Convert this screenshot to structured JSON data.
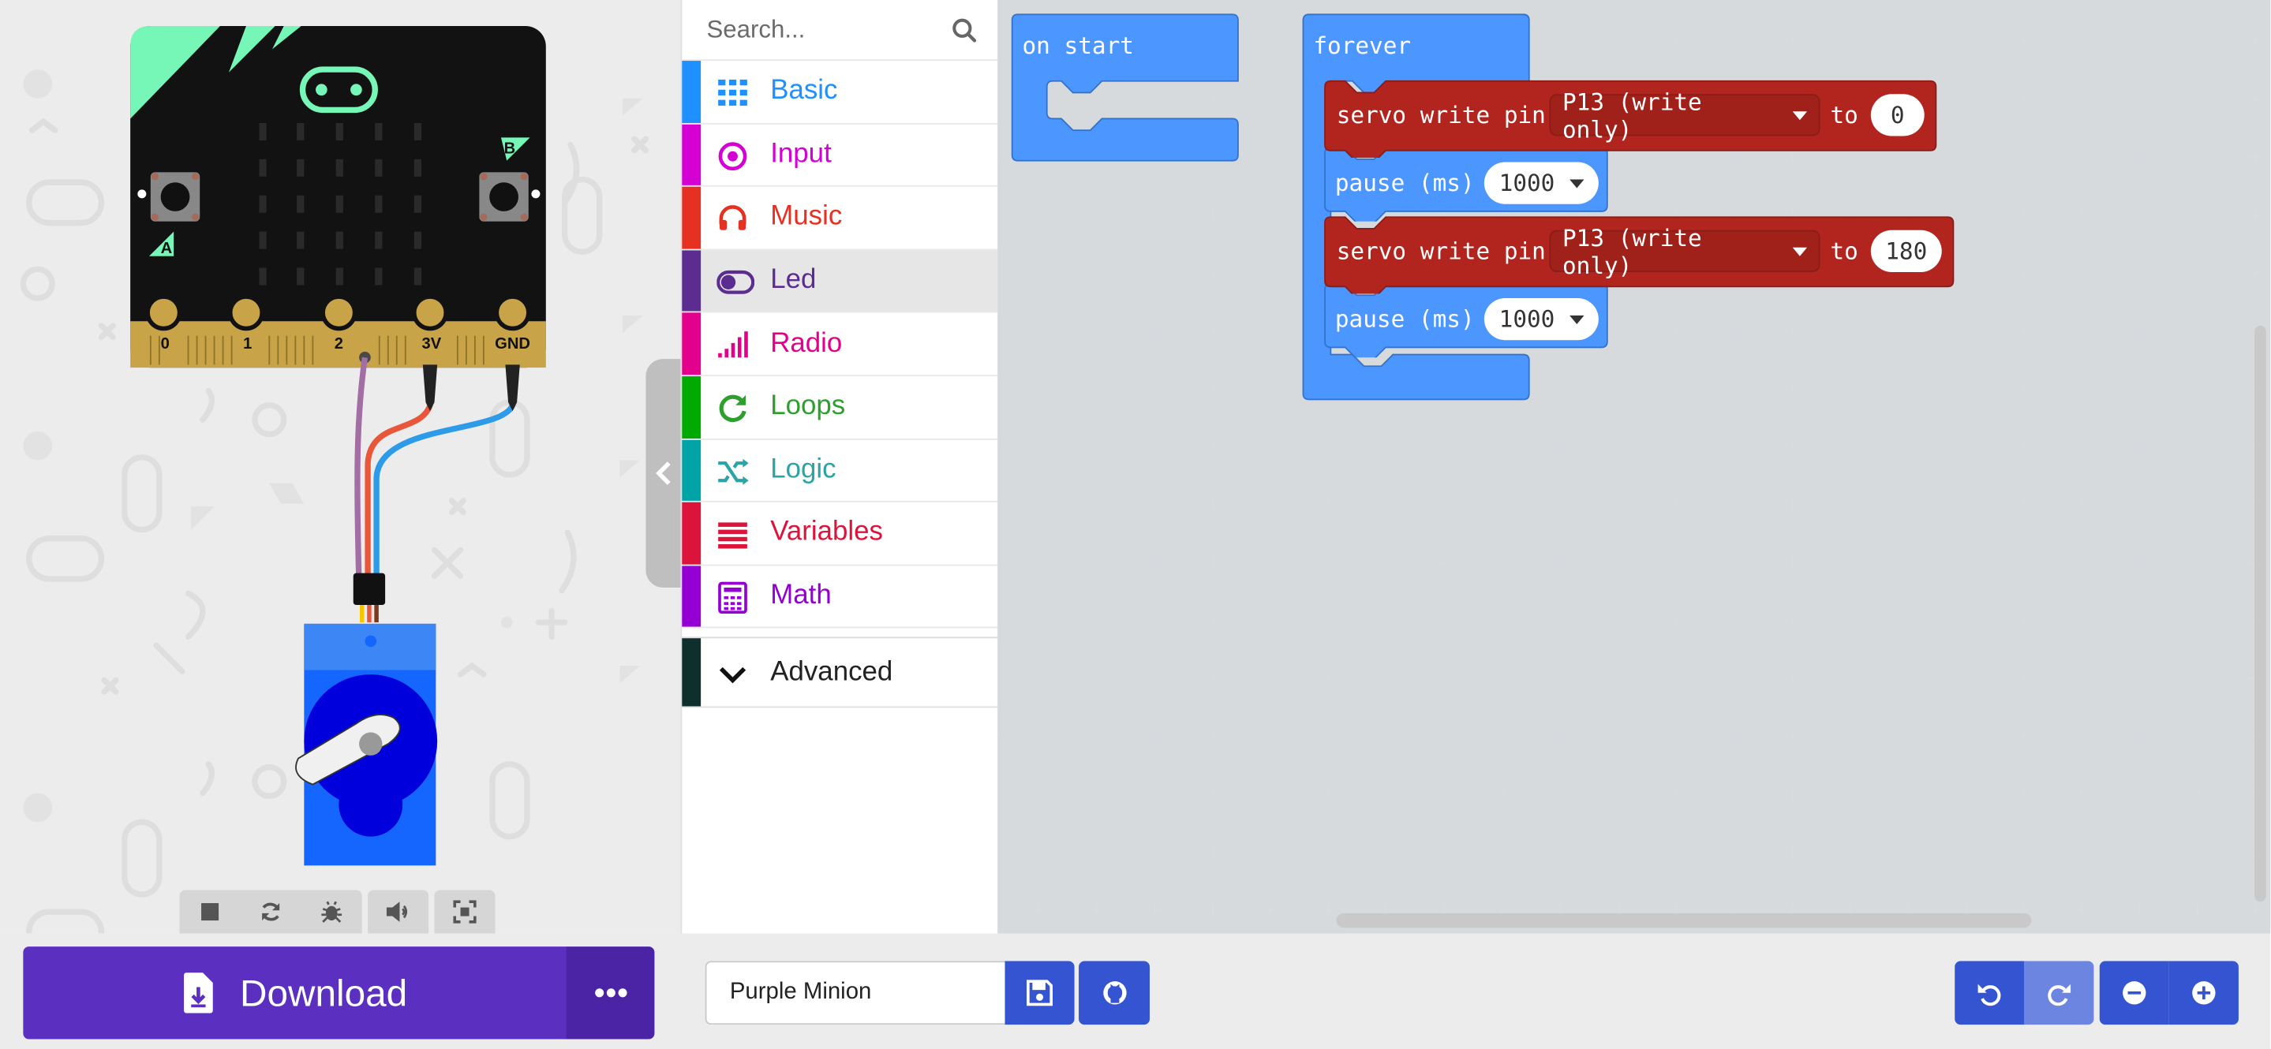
{
  "simulator": {
    "pin_labels": [
      "0",
      "1",
      "2",
      "3V",
      "GND"
    ],
    "button_a": "A",
    "button_b": "B",
    "toolbar_icons": [
      "stop-icon",
      "restart-icon",
      "debug-icon",
      "mute-icon",
      "fullscreen-icon"
    ]
  },
  "toolbox": {
    "search_placeholder": "Search...",
    "categories": [
      {
        "label": "Basic",
        "color": "#1e90ff",
        "icon": "grid-icon"
      },
      {
        "label": "Input",
        "color": "#d400d4",
        "icon": "target-icon"
      },
      {
        "label": "Music",
        "color": "#e63022",
        "icon": "headphones-icon"
      },
      {
        "label": "Led",
        "color": "#5c2d91",
        "icon": "toggle-icon",
        "active": true
      },
      {
        "label": "Radio",
        "color": "#e3008c",
        "icon": "signal-bars-icon"
      },
      {
        "label": "Loops",
        "color": "#00aa00",
        "icon": "refresh-icon"
      },
      {
        "label": "Logic",
        "color": "#00a4a6",
        "icon": "shuffle-icon"
      },
      {
        "label": "Variables",
        "color": "#dc143c",
        "icon": "lines-icon"
      },
      {
        "label": "Math",
        "color": "#9400d3",
        "icon": "calculator-icon"
      }
    ],
    "advanced_label": "Advanced"
  },
  "workspace": {
    "on_start_label": "on start",
    "forever_label": "forever",
    "servo_block_1": {
      "label": "servo write pin",
      "pin": "P13 (write only)",
      "to": "to",
      "value": "0"
    },
    "pause_block_1": {
      "label": "pause (ms)",
      "value": "1000"
    },
    "servo_block_2": {
      "label": "servo write pin",
      "pin": "P13 (write only)",
      "to": "to",
      "value": "180"
    },
    "pause_block_2": {
      "label": "pause (ms)",
      "value": "1000"
    }
  },
  "bottom": {
    "download_label": "Download",
    "project_name": "Purple Minion"
  },
  "colors": {
    "download": "#5b2fc0",
    "action_blue": "#3454d1",
    "basic_block": "#4c97ff",
    "servo_block": "#b1251e"
  }
}
